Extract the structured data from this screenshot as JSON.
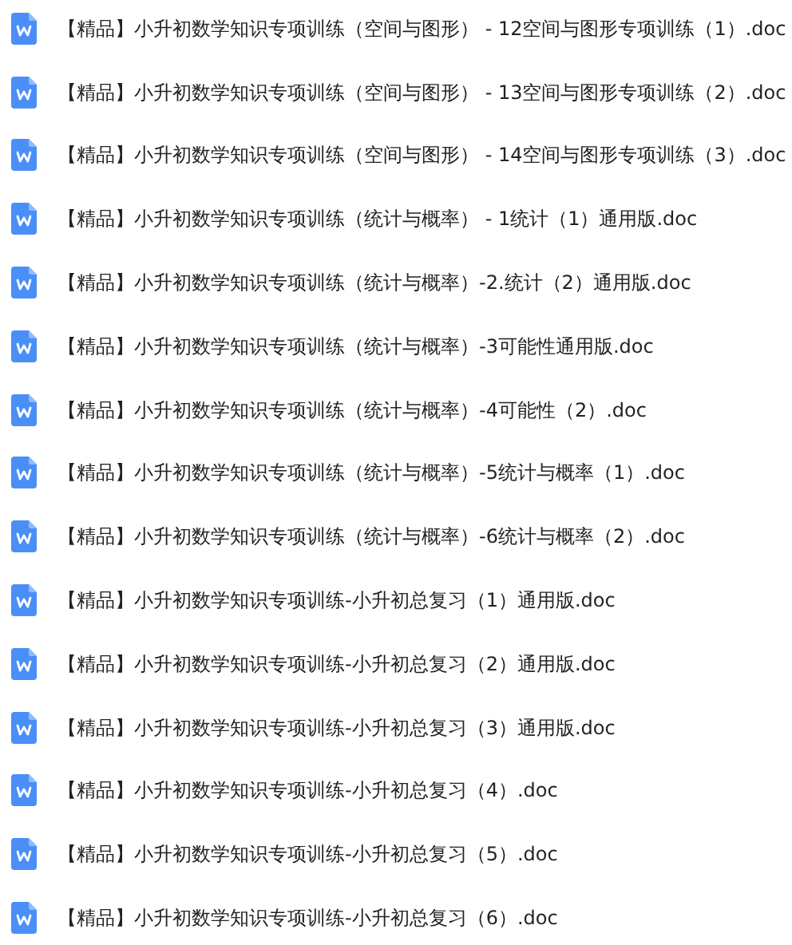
{
  "files": [
    {
      "name": "【精品】小升初数学知识专项训练（空间与图形） - 12空间与图形专项训练（1）.doc"
    },
    {
      "name": "【精品】小升初数学知识专项训练（空间与图形） - 13空间与图形专项训练（2）.doc"
    },
    {
      "name": "【精品】小升初数学知识专项训练（空间与图形） - 14空间与图形专项训练（3）.doc"
    },
    {
      "name": "【精品】小升初数学知识专项训练（统计与概率） - 1统计（1）通用版.doc"
    },
    {
      "name": "【精品】小升初数学知识专项训练（统计与概率）-2.统计（2）通用版.doc"
    },
    {
      "name": "【精品】小升初数学知识专项训练（统计与概率）-3可能性通用版.doc"
    },
    {
      "name": "【精品】小升初数学知识专项训练（统计与概率）-4可能性（2）.doc"
    },
    {
      "name": "【精品】小升初数学知识专项训练（统计与概率）-5统计与概率（1）.doc"
    },
    {
      "name": "【精品】小升初数学知识专项训练（统计与概率）-6统计与概率（2）.doc"
    },
    {
      "name": "【精品】小升初数学知识专项训练-小升初总复习（1）通用版.doc"
    },
    {
      "name": "【精品】小升初数学知识专项训练-小升初总复习（2）通用版.doc"
    },
    {
      "name": "【精品】小升初数学知识专项训练-小升初总复习（3）通用版.doc"
    },
    {
      "name": "【精品】小升初数学知识专项训练-小升初总复习（4）.doc"
    },
    {
      "name": "【精品】小升初数学知识专项训练-小升初总复习（5）.doc"
    },
    {
      "name": "【精品】小升初数学知识专项训练-小升初总复习（6）.doc"
    }
  ]
}
